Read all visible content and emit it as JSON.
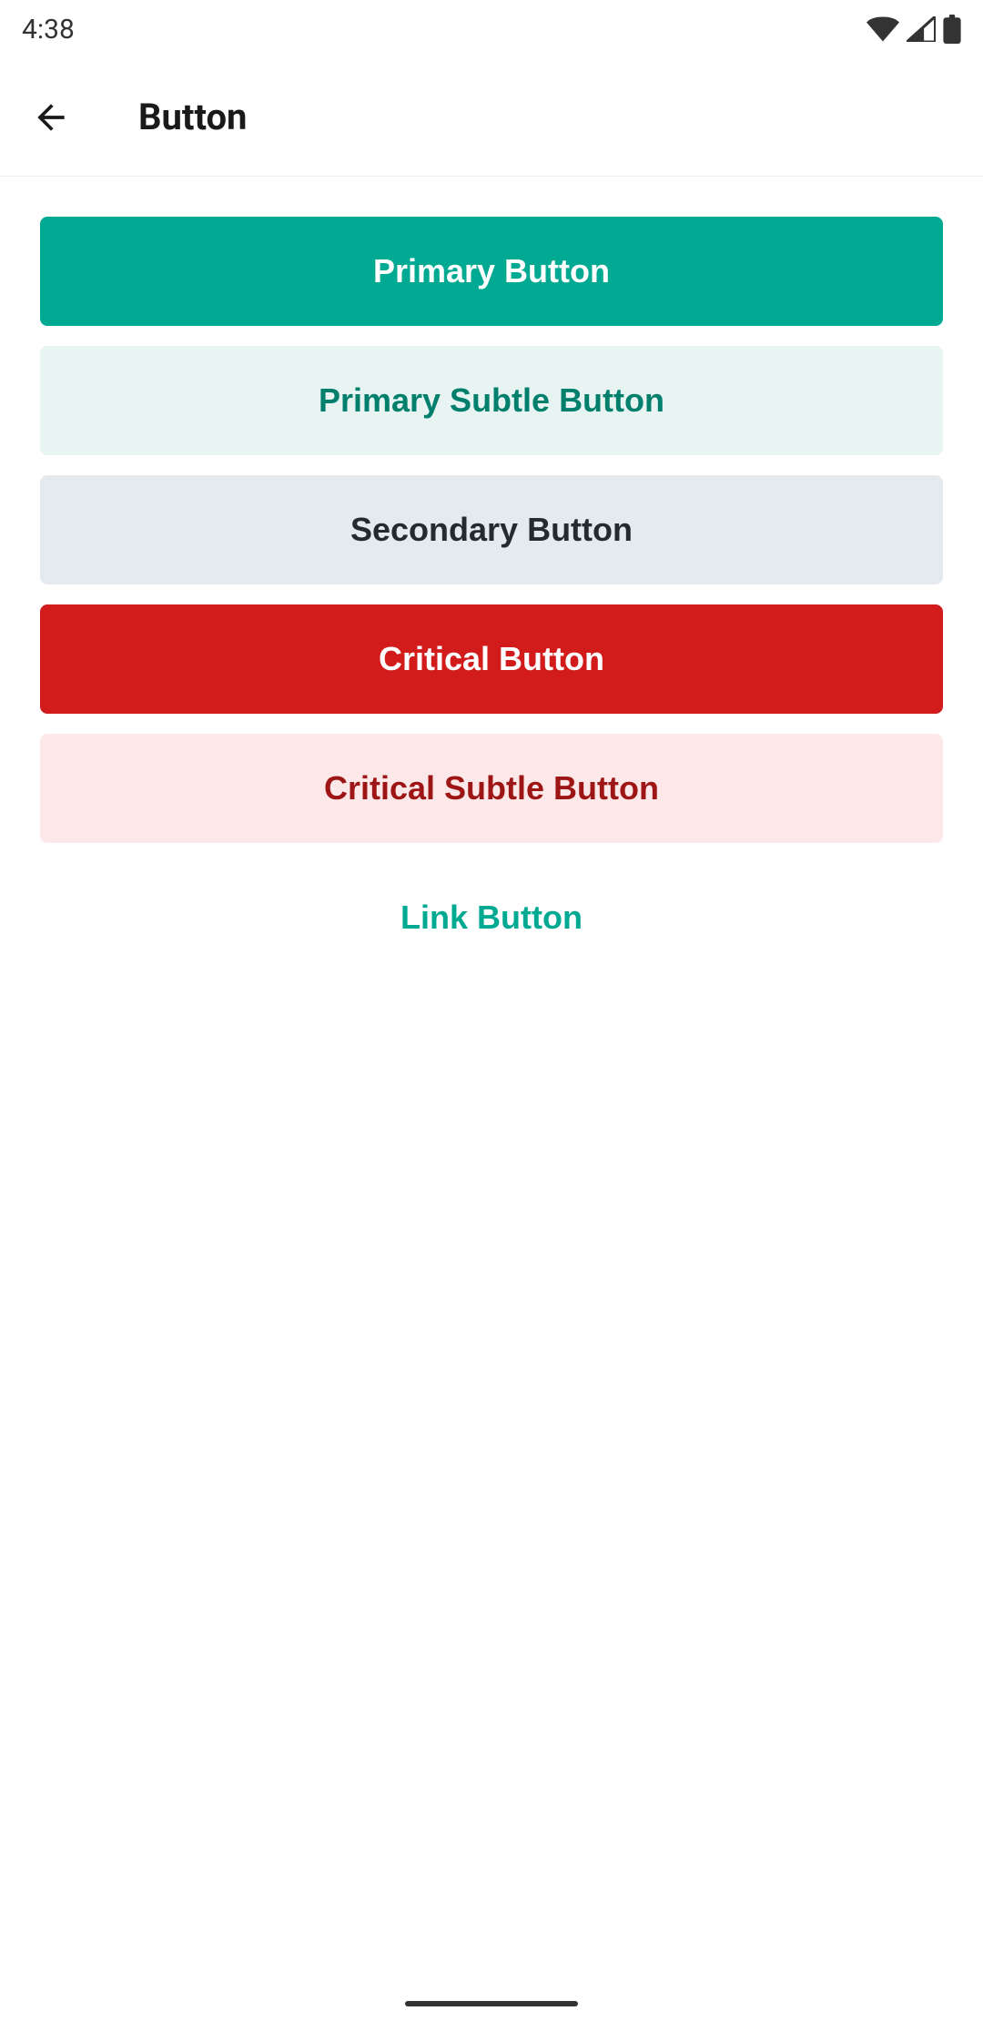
{
  "statusBar": {
    "time": "4:38"
  },
  "header": {
    "title": "Button"
  },
  "buttons": {
    "primary": "Primary Button",
    "primarySubtle": "Primary Subtle Button",
    "secondary": "Secondary Button",
    "critical": "Critical Button",
    "criticalSubtle": "Critical Subtle Button",
    "link": "Link Button"
  },
  "colors": {
    "primary": "#00a991",
    "primarySubtleBg": "#e8f4f2",
    "primarySubtleText": "#007f6d",
    "secondaryBg": "#e5eaef",
    "secondaryText": "#252a31",
    "critical": "#d21c1c",
    "criticalSubtleBg": "#fce8e8",
    "criticalSubtleText": "#9d1515"
  }
}
